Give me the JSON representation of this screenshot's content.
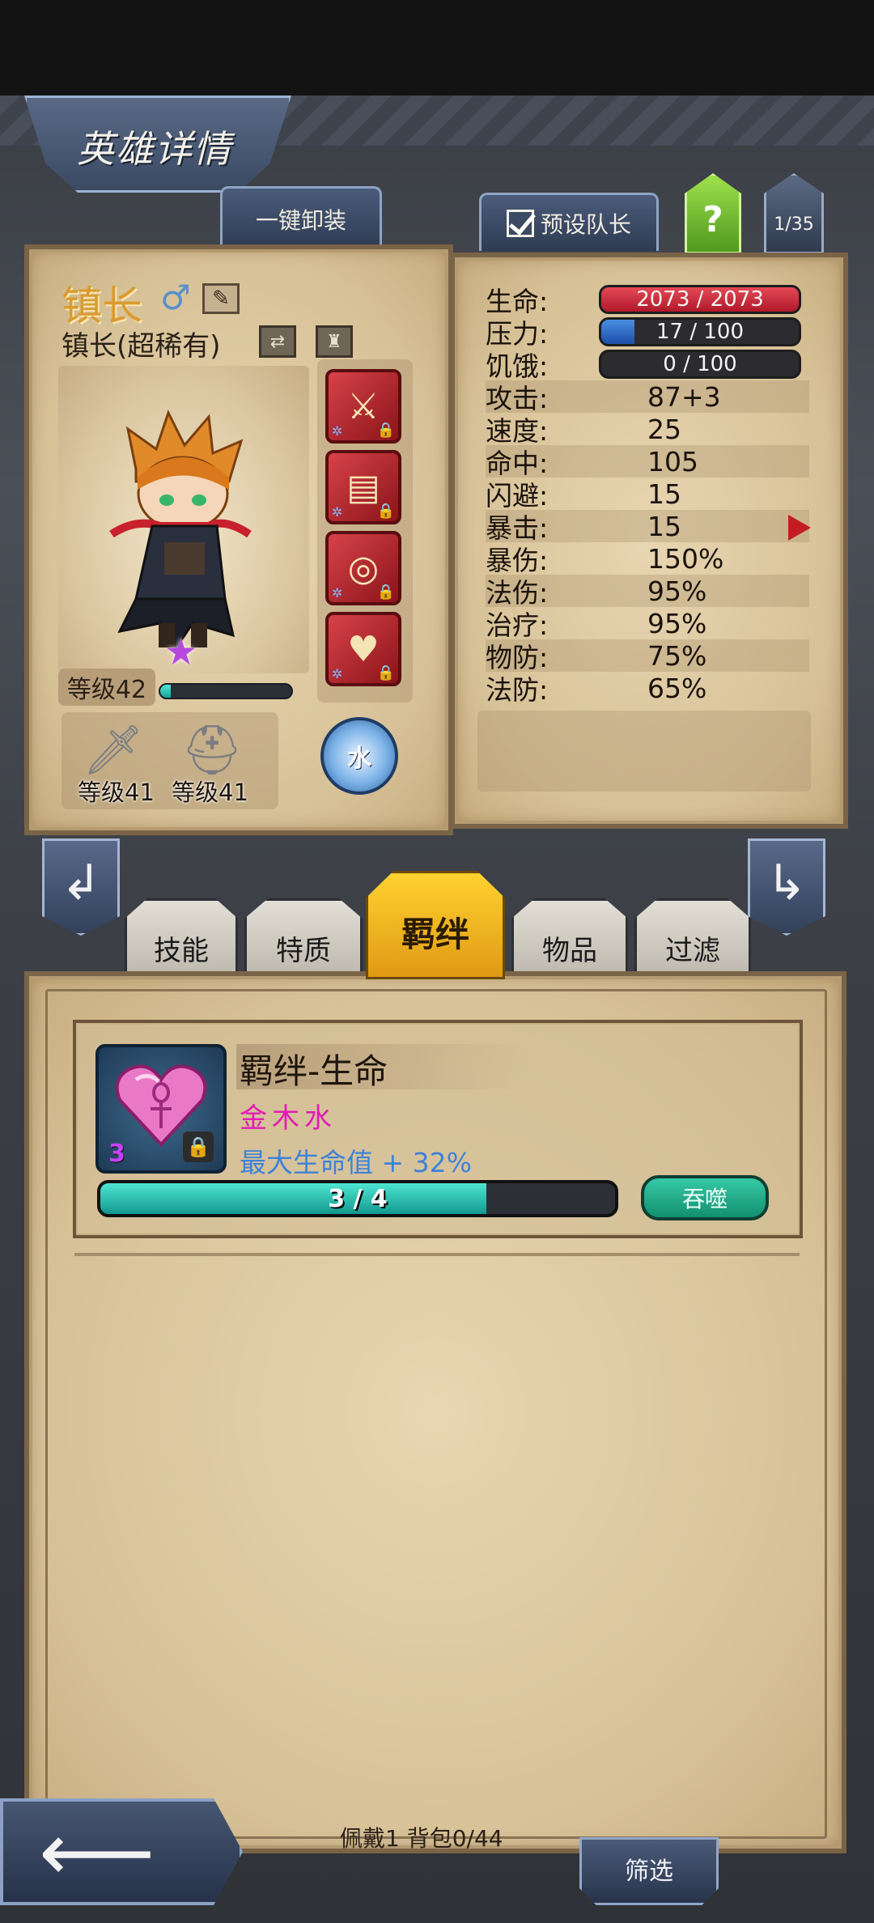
{
  "header": {
    "title": "英雄详情",
    "unequip_all_label": "一键卸装",
    "preset_leader_label": "预设队长",
    "help_label": "?",
    "page_count": "1/35"
  },
  "hero": {
    "name": "镇长",
    "gender_symbol": "♂",
    "rank_text": "镇长(超稀有)",
    "level_text": "等级42",
    "xp_fraction": 0.08,
    "element": "水",
    "gear": [
      {
        "icon": "sword-icon",
        "label": "等级41"
      },
      {
        "icon": "helmet-icon",
        "label": "等级41"
      }
    ]
  },
  "stats": {
    "hp": {
      "label": "生命:",
      "value": "2073 / 2073",
      "fraction": 1.0
    },
    "stress": {
      "label": "压力:",
      "value": "17 / 100",
      "fraction": 0.17
    },
    "hunger": {
      "label": "饥饿:",
      "value": "0 / 100",
      "fraction": 0.0
    },
    "rows": [
      {
        "label": "攻击:",
        "value": "87+3"
      },
      {
        "label": "速度:",
        "value": "25"
      },
      {
        "label": "命中:",
        "value": "105"
      },
      {
        "label": "闪避:",
        "value": "15"
      },
      {
        "label": "暴击:",
        "value": "15"
      },
      {
        "label": "暴伤:",
        "value": "150%"
      },
      {
        "label": "法伤:",
        "value": "95%"
      },
      {
        "label": "治疗:",
        "value": "95%"
      },
      {
        "label": "物防:",
        "value": "75%"
      },
      {
        "label": "法防:",
        "value": "65%"
      }
    ]
  },
  "tabs": {
    "skills": "技能",
    "traits": "特质",
    "bonds": "羁绊",
    "items": "物品",
    "filter": "过滤"
  },
  "bond": {
    "title": "羁绊-生命",
    "elements": "金木水",
    "effect": "最大生命值 + 32%",
    "count": "3",
    "progress_text": "3 / 4",
    "progress_fraction": 0.75,
    "devour_label": "吞噬"
  },
  "footer": {
    "inventory_status": "佩戴1 背包0/44",
    "screen_label": "筛选"
  },
  "colors": {
    "hp_bar": "#c92233",
    "stress_bar": "#2a62c4",
    "progress_bar": "#1fb8a8",
    "bond_tab": "#f4b820",
    "elements_text": "#e31bb6",
    "effect_text": "#3e82d8"
  }
}
